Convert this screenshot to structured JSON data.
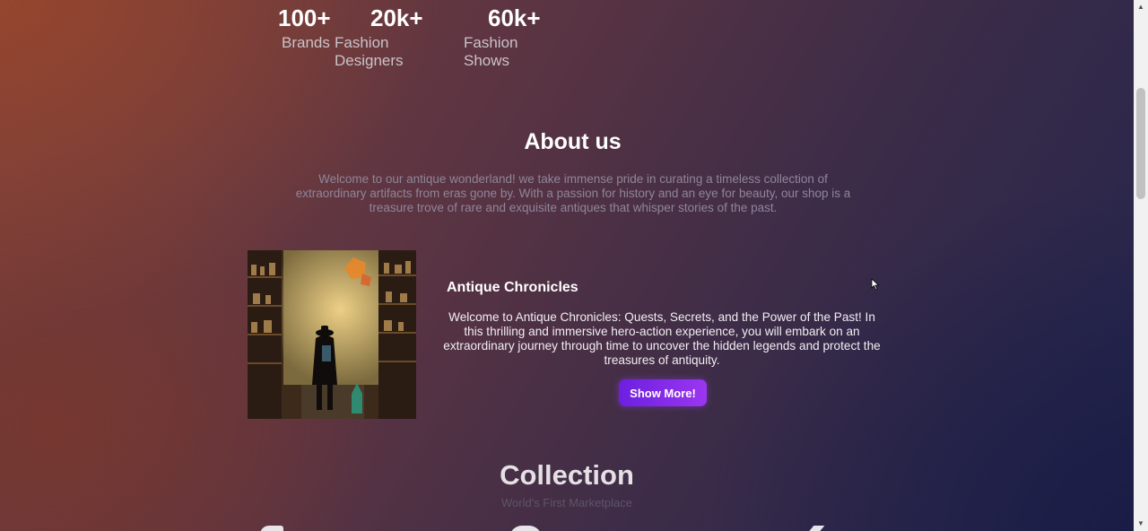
{
  "stats": [
    {
      "value": "100+",
      "label": "Brands"
    },
    {
      "value": "20k+",
      "label": "Fashion Designers"
    },
    {
      "value": "60k+",
      "label": "Fashion Shows"
    }
  ],
  "about": {
    "title": "About us",
    "text": "Welcome to our antique wonderland! we take immense pride in curating a timeless collection of extraordinary artifacts from eras gone by. With a passion for history and an eye for beauty, our shop is a treasure trove of rare and exquisite antiques that whisper stories of the past."
  },
  "card": {
    "title": "Antique Chronicles",
    "text": "Welcome to Antique Chronicles: Quests, Secrets, and the Power of the Past! In this thrilling and immersive hero-action experience, you will embark on an extraordinary journey through time to uncover the hidden legends and protect the treasures of antiquity.",
    "button_label": "Show More!"
  },
  "collection": {
    "title": "Collection",
    "subtitle": "World's First Marketplace"
  },
  "colors": {
    "button_start": "#6d1fe0",
    "button_end": "#9b36f0",
    "bg_warm": "#7b3f3b",
    "bg_cool": "#22254d"
  },
  "icons": {
    "scroll_up": "▲",
    "scroll_down": "▼"
  }
}
